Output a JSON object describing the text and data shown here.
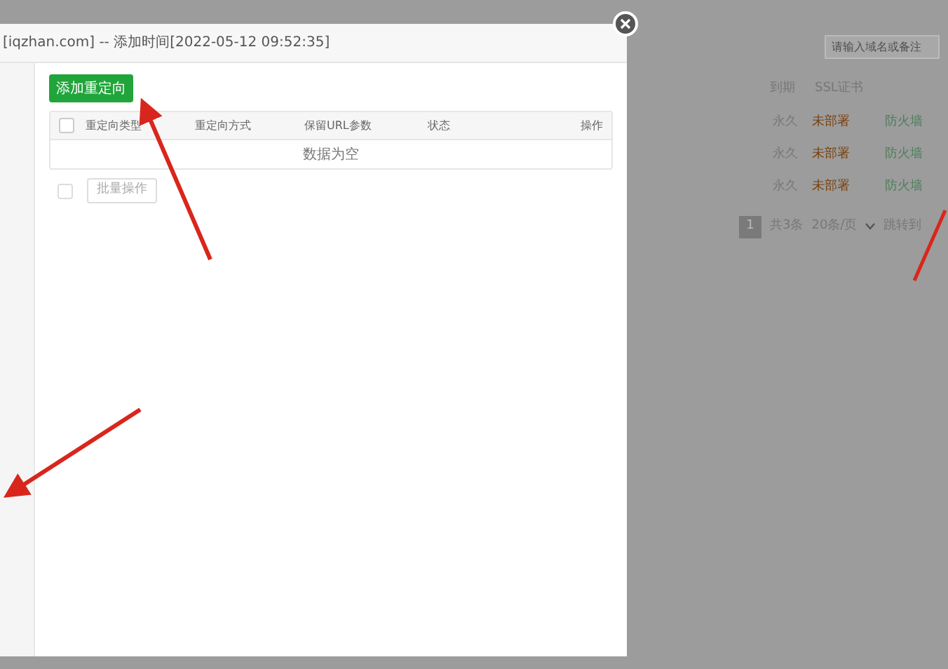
{
  "dialog": {
    "title": "[iqzhan.com] -- 添加时间[2022-05-12 09:52:35]",
    "add_button": "添加重定向",
    "columns": [
      "重定向类型",
      "重定向方式",
      "保留URL参数",
      "状态",
      "操作"
    ],
    "empty_text": "数据为空",
    "select_all": {
      "checked": false
    },
    "batch_checkbox": {
      "checked": false
    },
    "batch_button": "批量操作"
  },
  "background": {
    "search": {
      "placeholder": "请输入域名或备注"
    },
    "columns": [
      "到期",
      "SSL证书"
    ],
    "rows": [
      {
        "expiry": "永久",
        "ssl": "未部署",
        "action": "防火墙"
      },
      {
        "expiry": "永久",
        "ssl": "未部署",
        "action": "防火墙"
      },
      {
        "expiry": "永久",
        "ssl": "未部署",
        "action": "防火墙"
      }
    ],
    "pagination": {
      "page": "1",
      "total": "共3条",
      "per_page": "20条/页",
      "jump": "跳转到"
    }
  }
}
